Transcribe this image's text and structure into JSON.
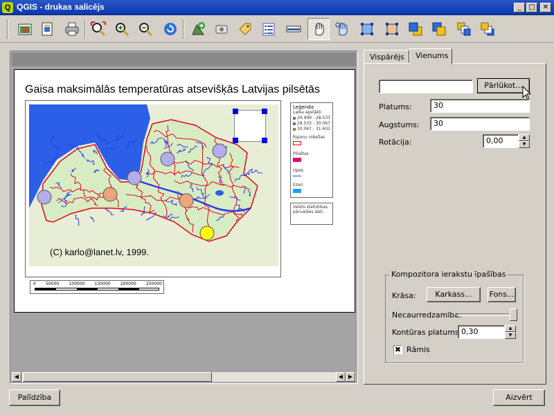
{
  "window": {
    "title": "QGIS - drukas salicējs",
    "app_icon_letter": "Q",
    "minimize": "_",
    "maximize": "□",
    "close": "✕"
  },
  "toolbar": {
    "icons": [
      "add-map-icon",
      "add-label-icon",
      "print-icon",
      "zoom-full-icon",
      "zoom-in-icon",
      "zoom-out-icon",
      "refresh-icon",
      "add-new-map-icon",
      "add-image-icon",
      "add-label-tag-icon",
      "add-legend-icon",
      "add-scalebar-icon",
      "select-move-item-icon",
      "move-content-icon",
      "group-icon",
      "ungroup-icon",
      "raise-icon",
      "lower-icon",
      "move-to-top-icon",
      "move-to-bottom-icon"
    ]
  },
  "composition": {
    "title": "Gaisa maksimālās temperatūras atsevišķās Latvijas pilsētās",
    "credit": "(C) karlo@lanet.lv, 1999.",
    "legend": {
      "title": "Leģenda",
      "layer1": "Laika apstākļi",
      "classes": [
        "26.999 - 28.533",
        "28.533 - 30.067",
        "30.067 - 31.601"
      ],
      "layer2": "Rajonu robežas",
      "layer3": "Pilsētas",
      "layer4": "Upes",
      "layer5": "Ezeri"
    },
    "source_text": "Valsts statistikas pārvaldes dati.",
    "scalebar_labels": [
      "0",
      "50000",
      "100000",
      "150000",
      "200000",
      "250000"
    ],
    "points": [
      {
        "city": "Ventspils",
        "class": 1
      },
      {
        "city": "Kuldīga",
        "class": 2
      },
      {
        "city": "Rīga",
        "class": 1
      },
      {
        "city": "Cēsis",
        "class": 1
      },
      {
        "city": "Alūksne",
        "class": 1
      },
      {
        "city": "Jēkabpils",
        "class": 2
      },
      {
        "city": "Daugavpils",
        "class": 3
      }
    ],
    "colors": {
      "class1": "#b4acec",
      "class2": "#f0a47a",
      "class3": "#ffff00",
      "land": "#e8eed6",
      "sea": "#2b5fe8",
      "districts": "#e8001a",
      "rivers": "#2a3ae8"
    }
  },
  "tabs": [
    {
      "label": "Vispārējs",
      "selected": false
    },
    {
      "label": "Vienums",
      "selected": true
    }
  ],
  "item": {
    "file_value": "",
    "browse_label": "Pārlūkot...",
    "width_label": "Platums:",
    "width_value": "30",
    "height_label": "Augstums:",
    "height_value": "30",
    "rotation_label": "Rotācija:",
    "rotation_value": "0,00"
  },
  "composer_props": {
    "group_title": "Kompozitora ierakstu īpašības",
    "color_label": "Krāsa:",
    "frame_button": "Karkass...",
    "background_button": "Fons...",
    "opacity_label": "Necaurredzamība:",
    "opacity_value": 0.98,
    "outline_label": "Kontūras platums",
    "outline_value": "0,30",
    "frame_checkbox_label": "Rāmis",
    "frame_checked": "✖"
  },
  "footer": {
    "help_label": "Palīdzība",
    "close_label": "Aizvērt"
  }
}
